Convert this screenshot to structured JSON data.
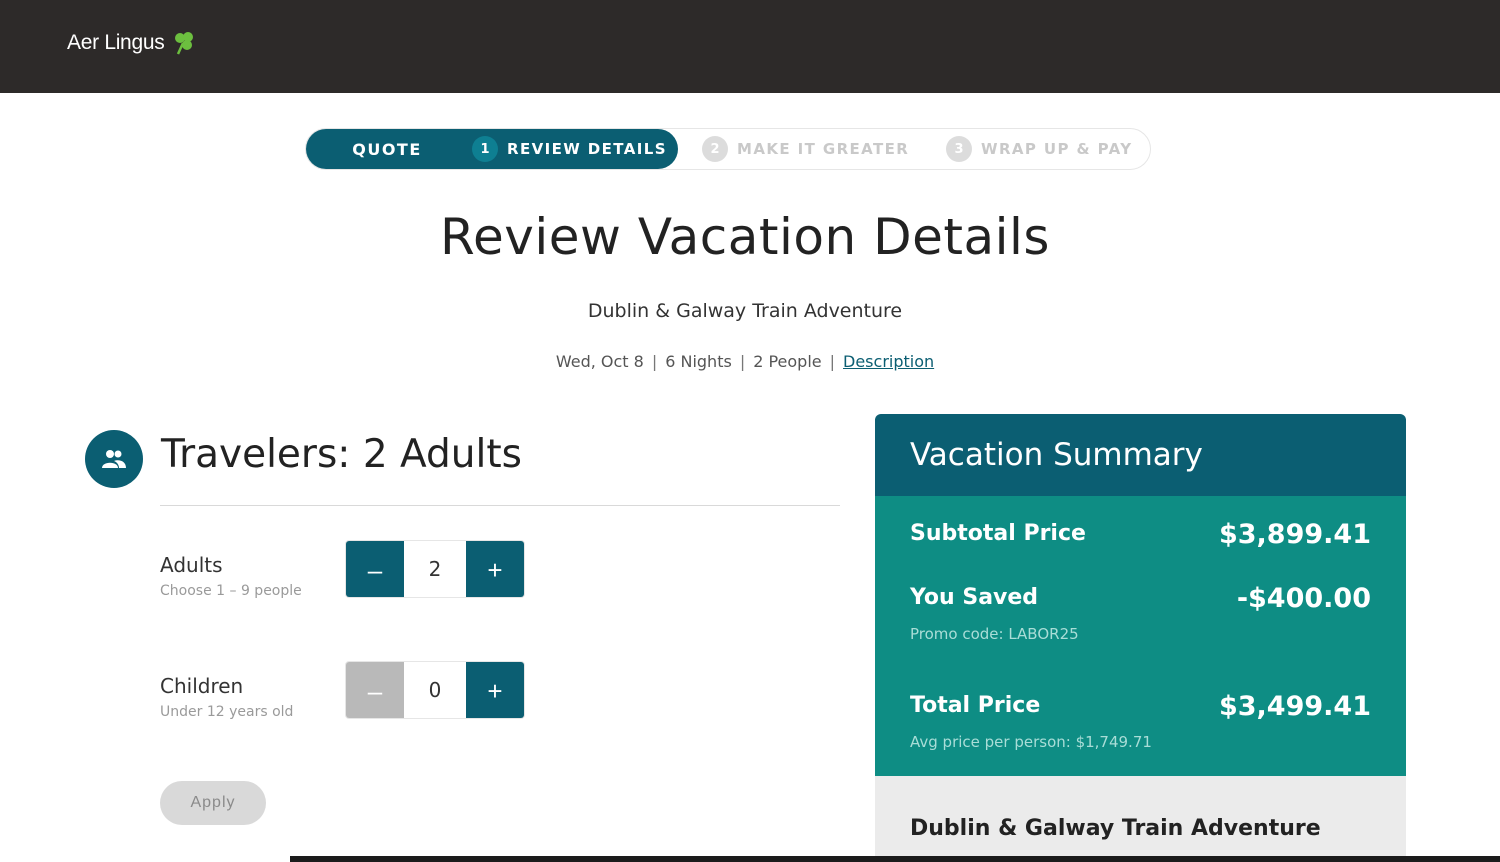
{
  "header": {
    "brand": "Aer Lingus",
    "logo_icon": "shamrock-icon"
  },
  "steps": {
    "quote": "QUOTE",
    "items": [
      {
        "num": "1",
        "label": "REVIEW DETAILS",
        "state": "active"
      },
      {
        "num": "2",
        "label": "MAKE IT GREATER",
        "state": "inactive"
      },
      {
        "num": "3",
        "label": "WRAP UP & PAY",
        "state": "inactive"
      }
    ]
  },
  "page": {
    "title": "Review Vacation Details",
    "subtitle": "Dublin & Galway Train Adventure",
    "meta": {
      "date": "Wed, Oct 8",
      "nights": "6 Nights",
      "people": "2 People",
      "link": "Description"
    }
  },
  "travelers": {
    "title": "Travelers: 2 Adults",
    "adults": {
      "label": "Adults",
      "hint": "Choose 1 – 9 people",
      "value": "2",
      "minus": "–",
      "plus": "+"
    },
    "children": {
      "label": "Children",
      "hint": "Under 12 years old",
      "value": "0",
      "minus": "–",
      "plus": "+"
    },
    "apply": "Apply"
  },
  "summary": {
    "title": "Vacation Summary",
    "subtotal_label": "Subtotal Price",
    "subtotal_value": "$3,899.41",
    "saved_label": "You Saved",
    "saved_value": "-$400.00",
    "promo": "Promo code: LABOR25",
    "total_label": "Total Price",
    "total_value": "$3,499.41",
    "avg": "Avg price per person: $1,749.71",
    "package": "Dublin & Galway Train Adventure"
  },
  "colors": {
    "brand": "#0b5e72",
    "summary_body": "#0e8d84",
    "topbar": "#2d2a29",
    "shamrock": "#6cbf3f"
  }
}
